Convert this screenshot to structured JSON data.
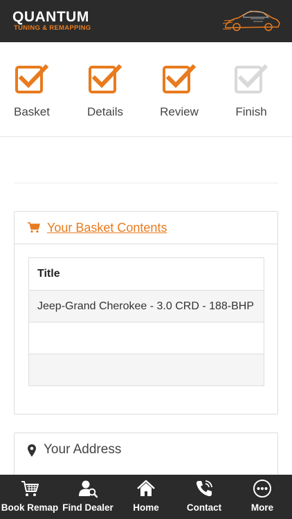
{
  "header": {
    "logo_main": "QUANTUM",
    "logo_sub": "TUNING & REMAPPING"
  },
  "steps": [
    {
      "label": "Basket",
      "state": "complete"
    },
    {
      "label": "Details",
      "state": "complete"
    },
    {
      "label": "Review",
      "state": "complete"
    },
    {
      "label": "Finish",
      "state": "pending"
    }
  ],
  "colors": {
    "accent": "#e87b1e",
    "pending": "#cfcfcf",
    "bar": "#2b2b2b"
  },
  "basket": {
    "title": "Your Basket Contents",
    "table": {
      "header": "Title",
      "rows": [
        "Jeep-Grand Cherokee - 3.0 CRD - 188-BHP",
        "",
        ""
      ]
    }
  },
  "address": {
    "title": "Your Address"
  },
  "bottom_nav": [
    {
      "label": "Book Remap",
      "icon": "cart-icon"
    },
    {
      "label": "Find Dealer",
      "icon": "user-search-icon"
    },
    {
      "label": "Home",
      "icon": "home-icon"
    },
    {
      "label": "Contact",
      "icon": "phone-icon"
    },
    {
      "label": "More",
      "icon": "more-icon"
    }
  ]
}
